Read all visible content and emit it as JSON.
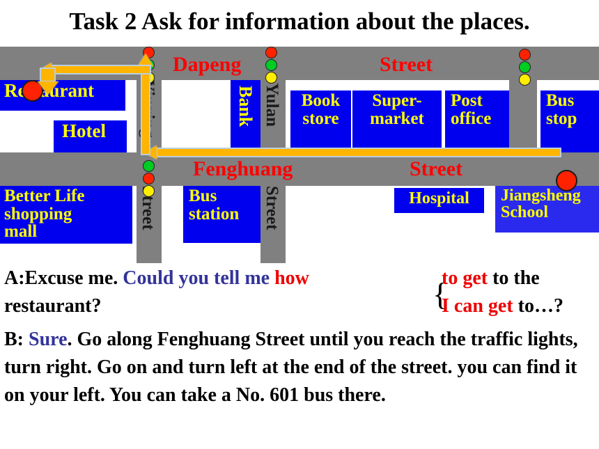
{
  "title": "Task 2 Ask for information about the places.",
  "map": {
    "streets": {
      "top_name": "Dapeng",
      "top_suffix": "Street",
      "mid_name": "Fenghuang",
      "mid_suffix": "Street",
      "vertical_left_name": "Yinxing",
      "vertical_left_suffix": "Street",
      "vertical_mid_name": "Yulan",
      "vertical_mid_suffix": "Street"
    },
    "places": {
      "restaurant": "Restaurant",
      "hotel": "Hotel",
      "bank": "Bank",
      "book_store": "Book\nstore",
      "book_store_l1": "Book",
      "book_store_l2": "store",
      "supermarket_l1": "Super-",
      "supermarket_l2": "market",
      "post_office_l1": "Post",
      "post_office_l2": "office",
      "bus_stop_l1": "Bus",
      "bus_stop_l2": "stop",
      "shopping_mall_l1": "Better Life",
      "shopping_mall_l2": "shopping",
      "shopping_mall_l3": "mall",
      "bus_station_l1": "Bus",
      "bus_station_l2": "station",
      "hospital": "Hospital",
      "school_l1": "Jiangsheng",
      "school_l2": "School"
    },
    "traffic_lights": [
      {
        "name": "yinxing-dapeng-light",
        "colors": [
          "red",
          "green",
          "yellow"
        ]
      },
      {
        "name": "yulan-dapeng-light",
        "colors": [
          "red",
          "green",
          "yellow"
        ]
      },
      {
        "name": "east-dapeng-light",
        "colors": [
          "red",
          "green",
          "yellow"
        ]
      },
      {
        "name": "yinxing-fenghuang-light",
        "colors": [
          "green",
          "red",
          "yellow"
        ]
      }
    ],
    "markers": [
      {
        "name": "restaurant-marker",
        "color": "#ff2200"
      },
      {
        "name": "school-marker",
        "color": "#ff2200"
      }
    ],
    "colors": {
      "road": "#808080",
      "building": "#0000ee",
      "building_text": "#ffff00",
      "street_label": "#ff0000",
      "route_arrow": "#ffb400",
      "marker": "#ff2200"
    }
  },
  "dialogue": {
    "line_a_1": "A:Excuse me. ",
    "line_a_2": "Could you tell me ",
    "line_a_3": "how",
    "line_a_4": "to get",
    "line_a_5": " to the",
    "line_a_6": "restaurant?",
    "alt_1": "I can get",
    "alt_2": " to…?",
    "brace": "{",
    "line_b_1": "B: ",
    "line_b_2": "Sure",
    "line_b_3": ". Go along Fenghuang Street until you reach the traffic lights, turn right. Go on and turn left at the end of the street. you can find it on your left. You can take a No. 601 bus there."
  }
}
